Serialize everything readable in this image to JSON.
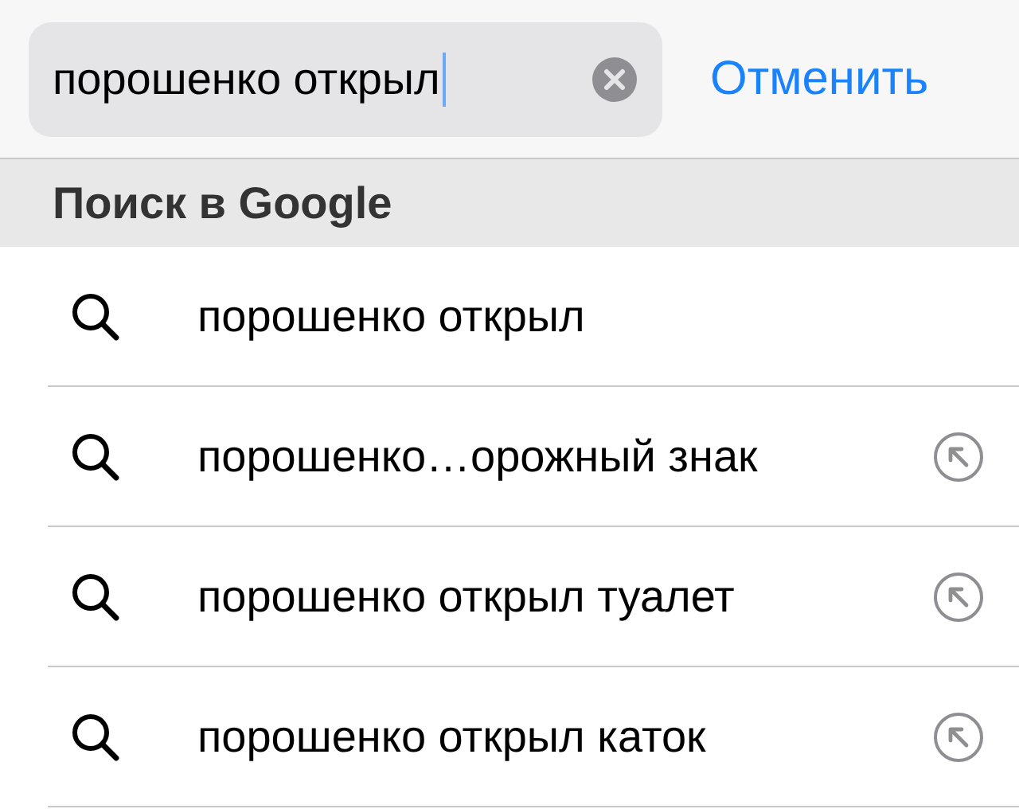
{
  "search": {
    "value": "порошенко открыл",
    "cancel": "Отменить"
  },
  "section": {
    "title": "Поиск в Google"
  },
  "suggestions": [
    {
      "text": "порошенко открыл",
      "fill_arrow": false
    },
    {
      "text": "порошенко…орожный знак",
      "fill_arrow": true
    },
    {
      "text": "порошенко открыл туалет",
      "fill_arrow": true
    },
    {
      "text": "порошенко открыл каток",
      "fill_arrow": true
    }
  ]
}
